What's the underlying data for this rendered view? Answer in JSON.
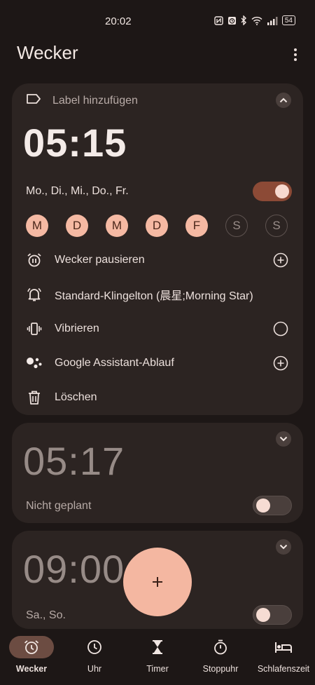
{
  "status_bar": {
    "time": "20:02",
    "battery": "54",
    "icons": [
      "nfc-icon",
      "alarm-status-icon",
      "bluetooth-icon",
      "wifi-icon",
      "signal-icon",
      "battery-icon"
    ]
  },
  "header": {
    "title": "Wecker",
    "menu_icon": "overflow-menu-icon"
  },
  "alarms": [
    {
      "label_placeholder": "Label hinzufügen",
      "time": "05:15",
      "schedule": "Mo., Di., Mi., Do., Fr.",
      "enabled": true,
      "expanded": true,
      "days": [
        {
          "letter": "M",
          "active": true
        },
        {
          "letter": "D",
          "active": true
        },
        {
          "letter": "M",
          "active": true
        },
        {
          "letter": "D",
          "active": true
        },
        {
          "letter": "F",
          "active": true
        },
        {
          "letter": "S",
          "active": false
        },
        {
          "letter": "S",
          "active": false
        }
      ],
      "options": {
        "pause": "Wecker pausieren",
        "ringtone": "Standard-Klingelton (晨星;Morning Star)",
        "vibrate": "Vibrieren",
        "assistant": "Google Assistant-Ablauf",
        "delete": "Löschen"
      }
    },
    {
      "time": "05:17",
      "schedule": "Nicht geplant",
      "enabled": false,
      "expanded": false
    },
    {
      "time": "09:00",
      "schedule": "Sa., So.",
      "enabled": false,
      "expanded": false
    }
  ],
  "fab": {
    "icon": "add-icon",
    "label": "+"
  },
  "bottom_nav": [
    {
      "label": "Wecker",
      "icon": "alarm-icon",
      "active": true
    },
    {
      "label": "Uhr",
      "icon": "clock-icon",
      "active": false
    },
    {
      "label": "Timer",
      "icon": "hourglass-icon",
      "active": false
    },
    {
      "label": "Stoppuhr",
      "icon": "stopwatch-icon",
      "active": false
    },
    {
      "label": "Schlafenszeit",
      "icon": "bed-icon",
      "active": false
    }
  ],
  "colors": {
    "background": "#1d1716",
    "card": "#2c2422",
    "accent": "#f5b9a3",
    "toggle_on": "#8c4a36",
    "nav_active": "#6c4c42"
  }
}
